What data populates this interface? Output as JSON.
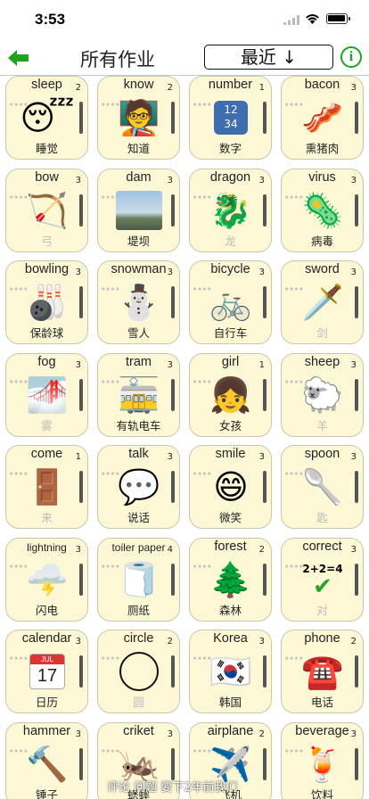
{
  "status": {
    "time": "3:53"
  },
  "header": {
    "back_icon": "arrow-left-icon",
    "title": "所有作业",
    "sort_label": "最近 ↓",
    "info_icon": "info-circle-icon",
    "accent_color": "#1aa51a"
  },
  "cards": [
    {
      "word": "sleep",
      "level": "2",
      "icon": "sleeping-face",
      "chinese": "睡觉",
      "faded": false
    },
    {
      "word": "know",
      "level": "2",
      "icon": "teacher-student",
      "chinese": "知道",
      "faded": false
    },
    {
      "word": "number",
      "level": "1",
      "icon": "numbers-1234",
      "chinese": "数字",
      "faded": false
    },
    {
      "word": "bacon",
      "level": "3",
      "icon": "bacon",
      "chinese": "熏猪肉",
      "faded": false
    },
    {
      "word": "bow",
      "level": "3",
      "icon": "bow-and-arrow",
      "chinese": "弓",
      "faded": true
    },
    {
      "word": "dam",
      "level": "3",
      "icon": "dam-photo",
      "chinese": "堤坝",
      "faded": false
    },
    {
      "word": "dragon",
      "level": "3",
      "icon": "dragon",
      "chinese": "龙",
      "faded": true
    },
    {
      "word": "virus",
      "level": "3",
      "icon": "virus",
      "chinese": "病毒",
      "faded": false
    },
    {
      "word": "bowling",
      "level": "3",
      "icon": "bowling",
      "chinese": "保龄球",
      "faded": false
    },
    {
      "word": "snowman",
      "level": "3",
      "icon": "snowman",
      "chinese": "雪人",
      "faded": false
    },
    {
      "word": "bicycle",
      "level": "3",
      "icon": "bicycle",
      "chinese": "自行车",
      "faded": false
    },
    {
      "word": "sword",
      "level": "3",
      "icon": "dagger",
      "chinese": "剑",
      "faded": true
    },
    {
      "word": "fog",
      "level": "3",
      "icon": "foggy",
      "chinese": "雾",
      "faded": true
    },
    {
      "word": "tram",
      "level": "3",
      "icon": "tram",
      "chinese": "有轨电车",
      "faded": false
    },
    {
      "word": "girl",
      "level": "1",
      "icon": "girl",
      "chinese": "女孩",
      "faded": false
    },
    {
      "word": "sheep",
      "level": "3",
      "icon": "sheep",
      "chinese": "羊",
      "faded": true
    },
    {
      "word": "come",
      "level": "1",
      "icon": "door-walking",
      "chinese": "来",
      "faded": true
    },
    {
      "word": "talk",
      "level": "3",
      "icon": "lips-speech",
      "chinese": "说话",
      "faded": false
    },
    {
      "word": "smile",
      "level": "3",
      "icon": "grinning-face",
      "chinese": "微笑",
      "faded": false
    },
    {
      "word": "spoon",
      "level": "3",
      "icon": "spoon",
      "chinese": "匙",
      "faded": true
    },
    {
      "word": "lightning",
      "level": "3",
      "icon": "thunder-cloud",
      "chinese": "闪电",
      "faded": false
    },
    {
      "word": "toiler paper",
      "level": "4",
      "icon": "toilet-paper",
      "chinese": "厕纸",
      "faded": false
    },
    {
      "word": "forest",
      "level": "2",
      "icon": "trees",
      "chinese": "森林",
      "faded": false
    },
    {
      "word": "correct",
      "level": "3",
      "icon": "check-math",
      "chinese": "对",
      "faded": true
    },
    {
      "word": "calendar",
      "level": "3",
      "icon": "calendar",
      "chinese": "日历",
      "faded": false
    },
    {
      "word": "circle",
      "level": "2",
      "icon": "circle",
      "chinese": "圆",
      "faded": true
    },
    {
      "word": "Korea",
      "level": "3",
      "icon": "korea-flag",
      "chinese": "韩国",
      "faded": false
    },
    {
      "word": "phone",
      "level": "2",
      "icon": "telephone",
      "chinese": "电话",
      "faded": false
    },
    {
      "word": "hammer",
      "level": "3",
      "icon": "hammer",
      "chinese": "锤子",
      "faded": false
    },
    {
      "word": "criket",
      "level": "3",
      "icon": "cricket-insect",
      "chinese": "蟋蟀",
      "faded": false
    },
    {
      "word": "airplane",
      "level": "2",
      "icon": "airplane",
      "chinese": "飞机",
      "faded": false
    },
    {
      "word": "beverage",
      "level": "3",
      "icon": "tropical-drink",
      "chinese": "饮料",
      "faded": false
    }
  ],
  "icon_glyphs": {
    "sleeping-face": "😴",
    "teacher-student": "🧑‍🏫",
    "bacon": "🥓",
    "bow-and-arrow": "🏹",
    "dragon": "🐉",
    "virus": "🦠",
    "bowling": "🎳",
    "snowman": "⛄",
    "bicycle": "🚲",
    "dagger": "🗡️",
    "foggy": "🌁",
    "tram": "🚋",
    "girl": "👧",
    "sheep": "🐑",
    "door-walking": "🚪",
    "lips-speech": "💬",
    "grinning-face": "😄",
    "spoon": "🥄",
    "thunder-cloud": "🌩️",
    "toilet-paper": "🧻",
    "trees": "🌲",
    "korea-flag": "🇰🇷",
    "telephone": "☎️",
    "hammer": "🔨",
    "cricket-insect": "🦗",
    "airplane": "✈️",
    "tropical-drink": "🍹"
  },
  "number_tile": "12 34",
  "calendar_tile": {
    "month": "JUL",
    "day": "17"
  },
  "math_tile": "2+2=4",
  "ticker_text": "评论 问题 要下2年前我们"
}
